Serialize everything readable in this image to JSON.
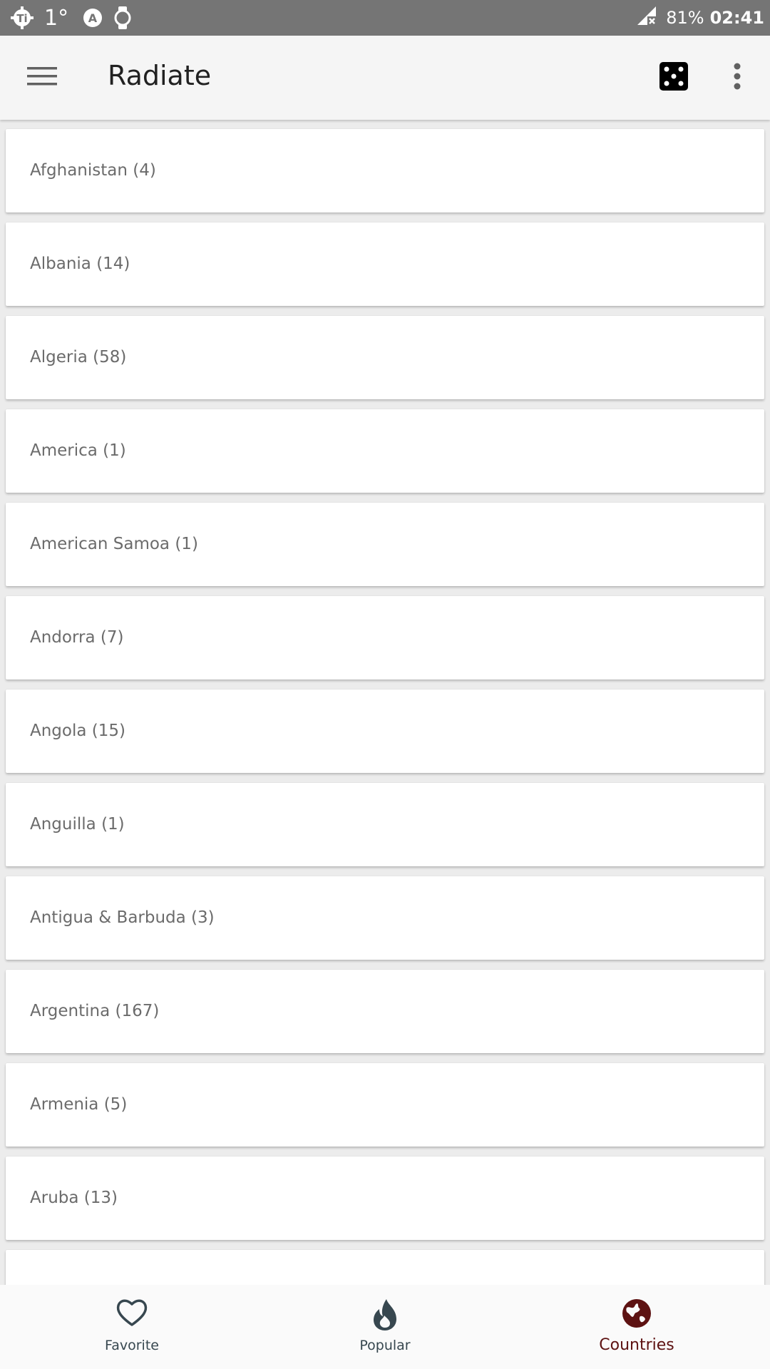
{
  "status_bar": {
    "temperature": "1°",
    "battery": "81%",
    "time": "02:41",
    "icons": [
      "app-notification-icon",
      "auto-brightness-icon",
      "watch-icon",
      "signal-no-connection-icon"
    ]
  },
  "app_bar": {
    "title": "Radiate",
    "icons": [
      "menu-icon",
      "dice-icon",
      "more-vert-icon"
    ]
  },
  "countries": [
    "Afghanistan (4)",
    "Albania (14)",
    "Algeria (58)",
    "America (1)",
    "American Samoa (1)",
    "Andorra (7)",
    "Angola (15)",
    "Anguilla (1)",
    "Antigua & Barbuda (3)",
    "Argentina (167)",
    "Armenia (5)",
    "Aruba (13)",
    ""
  ],
  "bottom_nav": {
    "items": [
      {
        "label": "Favorite",
        "icon": "heart-icon",
        "active": false
      },
      {
        "label": "Popular",
        "icon": "flame-icon",
        "active": false
      },
      {
        "label": "Countries",
        "icon": "globe-icon",
        "active": true
      }
    ]
  },
  "colors": {
    "status_bar": "#757575",
    "app_bar": "#f5f5f5",
    "nav_active": "#5d1212",
    "nav_inactive": "#37474f",
    "list_text": "#6b6b6b"
  }
}
